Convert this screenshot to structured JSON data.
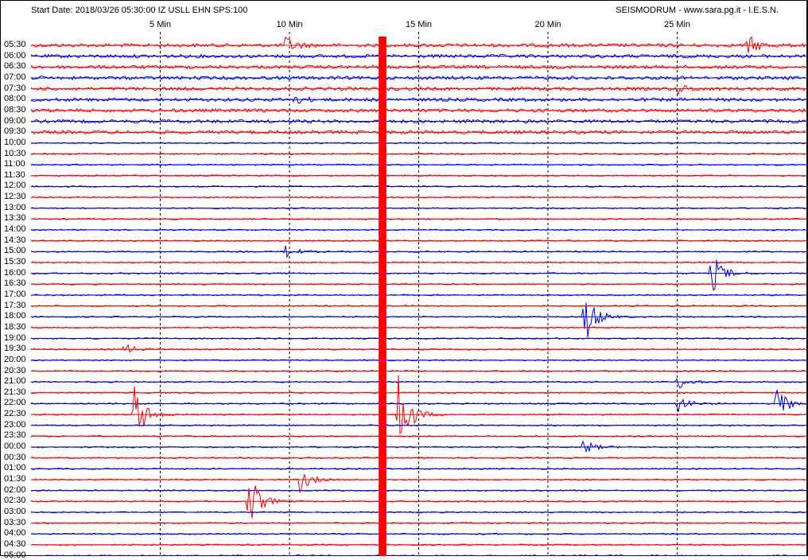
{
  "header": {
    "left": "Start Date: 2018/03/26 05:30:00 IZ USLL EHN SPS:100",
    "right": "SEISMODRUM - www.sara.pg.it - I.E.S.N."
  },
  "colors": {
    "trace_a": "#ff0000",
    "trace_b": "#0000ff",
    "grid": "#000000",
    "background": "#ffffff"
  },
  "chart_data": {
    "type": "line",
    "title": "",
    "xlabel": "",
    "ylabel": "",
    "xlim": [
      0,
      30
    ],
    "x_unit": "min",
    "x_ticks": [
      {
        "value": 5,
        "label": "5 Min"
      },
      {
        "value": 10,
        "label": "10 Min"
      },
      {
        "value": 15,
        "label": "15 Min"
      },
      {
        "value": 20,
        "label": "20 Min"
      },
      {
        "value": 25,
        "label": "25 Min"
      }
    ],
    "rows": [
      "05:30",
      "06:00",
      "06:30",
      "07:00",
      "07:30",
      "08:00",
      "08:30",
      "09:00",
      "09:30",
      "10:00",
      "10:30",
      "11:00",
      "11:30",
      "12:00",
      "12:30",
      "13:00",
      "13:30",
      "14:00",
      "14:30",
      "15:00",
      "15:30",
      "16:00",
      "16:30",
      "17:00",
      "17:30",
      "18:00",
      "18:30",
      "19:00",
      "19:30",
      "20:00",
      "20:30",
      "21:00",
      "21:30",
      "22:00",
      "22:30",
      "23:00",
      "23:30",
      "00:00",
      "00:30",
      "01:00",
      "01:30",
      "02:00",
      "02:30",
      "03:00",
      "03:30",
      "04:00",
      "04:30",
      "05:00"
    ],
    "row_colors": [
      "trace_a",
      "trace_b"
    ],
    "events": [
      {
        "row": "05:30",
        "minute": 9.8,
        "amplitude": 12,
        "color": "trace_a"
      },
      {
        "row": "05:30",
        "minute": 27.7,
        "amplitude": 14,
        "color": "trace_a"
      },
      {
        "row": "07:30",
        "minute": 25,
        "amplitude": 6,
        "color": "trace_a"
      },
      {
        "row": "08:00",
        "minute": 10,
        "amplitude": 8,
        "color": "trace_b"
      },
      {
        "row": "15:00",
        "minute": 9.8,
        "amplitude": 10,
        "color": "trace_b"
      },
      {
        "row": "16:00",
        "minute": 26.3,
        "amplitude": 30,
        "color": "trace_b"
      },
      {
        "row": "18:00",
        "minute": 21.4,
        "amplitude": 40,
        "color": "trace_b"
      },
      {
        "row": "19:30",
        "minute": 3.6,
        "amplitude": 8,
        "color": "trace_a"
      },
      {
        "row": "21:00",
        "minute": 25.0,
        "amplitude": 10,
        "color": "trace_b"
      },
      {
        "row": "22:00",
        "minute": 28.8,
        "amplitude": 26,
        "color": "trace_b"
      },
      {
        "row": "22:30",
        "minute": 4.0,
        "amplitude": 38,
        "color": "trace_a"
      },
      {
        "row": "22:30",
        "minute": 14.2,
        "amplitude": 60,
        "color": "trace_a"
      },
      {
        "row": "22:00",
        "minute": 25.0,
        "amplitude": 12,
        "color": "trace_b"
      },
      {
        "row": "01:30",
        "minute": 10.4,
        "amplitude": 16,
        "color": "trace_a"
      },
      {
        "row": "02:30",
        "minute": 8.4,
        "amplitude": 40,
        "color": "trace_a"
      },
      {
        "row": "00:00",
        "minute": 21.3,
        "amplitude": 12,
        "color": "trace_b"
      }
    ],
    "saturated_band": {
      "from_minute": 13.45,
      "to_minute": 13.75,
      "color": "trace_a"
    },
    "grid": true,
    "legend": "none"
  }
}
